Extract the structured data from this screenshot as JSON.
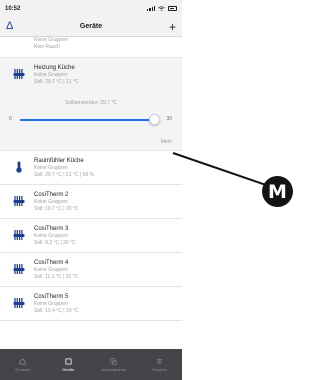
{
  "status_bar": {
    "time": "10:52"
  },
  "nav": {
    "title": "Geräte",
    "add_symbol": "+",
    "logo_symbol": "Δ"
  },
  "partial_row": {
    "line1": "Keine Gruppen",
    "line2": "Kein Rauch"
  },
  "heizung": {
    "name": "Heizung Küche",
    "groups": "Keine Gruppen",
    "values": "Soll: 29,7 °C | 21 °C"
  },
  "slider": {
    "label": "Solltemperatur: 29,7 °C",
    "min": "0",
    "max": "30",
    "value_fraction": 0.99,
    "more_label": "Mehr"
  },
  "devices": [
    {
      "name": "Raumfühler Küche",
      "groups": "Keine Gruppen",
      "values": "Soll: 29,7 °C | 21 °C | 58 %",
      "icon": "thermometer-icon"
    },
    {
      "name": "CosiTherm 2",
      "groups": "Keine Gruppen",
      "values": "Soll: 10,7 °C | 20 °C",
      "icon": "radiator-icon"
    },
    {
      "name": "CosiTherm 3",
      "groups": "Keine Gruppen",
      "values": "Soll: 9,3 °C | 20 °C",
      "icon": "radiator-icon"
    },
    {
      "name": "CosiTherm 4",
      "groups": "Keine Gruppen",
      "values": "Soll: 11,2 °C | 20 °C",
      "icon": "radiator-icon"
    },
    {
      "name": "CosiTherm 5",
      "groups": "Keine Gruppen",
      "values": "Soll: 10,4 °C | 20 °C",
      "icon": "radiator-icon"
    }
  ],
  "tabs": [
    {
      "label": "Zuhause",
      "icon": "home-icon"
    },
    {
      "label": "Geräte",
      "icon": "devices-icon"
    },
    {
      "label": "Automationen",
      "icon": "automation-icon"
    },
    {
      "label": "Gruppen",
      "icon": "groups-icon"
    }
  ],
  "callout": {
    "letter": "M"
  },
  "colors": {
    "accent": "#1a73e8",
    "icon_blue": "#1c3f8f",
    "tab_bar": "#44444a",
    "badge": "#141414"
  }
}
